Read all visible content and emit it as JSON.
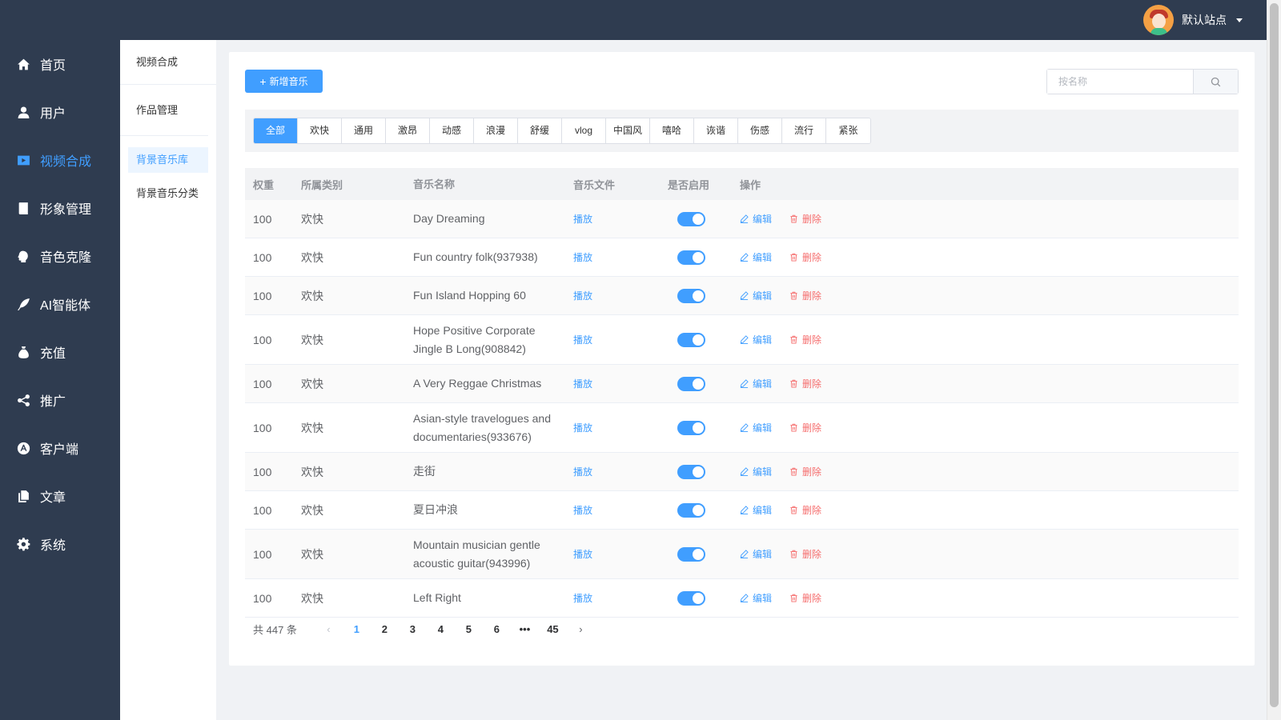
{
  "header": {
    "site_name": "默认站点"
  },
  "sidebar": {
    "items": [
      {
        "label": "首页",
        "icon": "home-icon",
        "active": false
      },
      {
        "label": "用户",
        "icon": "user-icon",
        "active": false
      },
      {
        "label": "视频合成",
        "icon": "video-icon",
        "active": true
      },
      {
        "label": "形象管理",
        "icon": "book-icon",
        "active": false
      },
      {
        "label": "音色克隆",
        "icon": "voice-icon",
        "active": false
      },
      {
        "label": "AI智能体",
        "icon": "feather-icon",
        "active": false
      },
      {
        "label": "充值",
        "icon": "money-bag-icon",
        "active": false
      },
      {
        "label": "推广",
        "icon": "share-icon",
        "active": false
      },
      {
        "label": "客户端",
        "icon": "app-store-icon",
        "active": false
      },
      {
        "label": "文章",
        "icon": "documents-icon",
        "active": false
      },
      {
        "label": "系统",
        "icon": "gear-icon",
        "active": false
      }
    ]
  },
  "subnav": {
    "title": "视频合成",
    "group": "作品管理",
    "items": [
      {
        "label": "背景音乐库",
        "active": true
      },
      {
        "label": "背景音乐分类",
        "active": false
      }
    ]
  },
  "toolbar": {
    "add_label": "新增音乐",
    "search_placeholder": "按名称"
  },
  "categories": [
    "全部",
    "欢快",
    "通用",
    "激昂",
    "动感",
    "浪漫",
    "舒缓",
    "vlog",
    "中国风",
    "嘻哈",
    "诙谐",
    "伤感",
    "流行",
    "紧张"
  ],
  "table": {
    "headers": {
      "weight": "权重",
      "category": "所属类别",
      "name": "音乐名称",
      "file": "音乐文件",
      "enabled": "是否启用",
      "ops": "操作"
    },
    "play_label": "播放",
    "edit_label": "编辑",
    "delete_label": "删除",
    "rows": [
      {
        "weight": "100",
        "category": "欢快",
        "name": "Day Dreaming",
        "enabled": true
      },
      {
        "weight": "100",
        "category": "欢快",
        "name": "Fun country folk(937938)",
        "enabled": true
      },
      {
        "weight": "100",
        "category": "欢快",
        "name": "Fun Island Hopping 60",
        "enabled": true
      },
      {
        "weight": "100",
        "category": "欢快",
        "name": "Hope Positive Corporate Jingle B Long(908842)",
        "enabled": true
      },
      {
        "weight": "100",
        "category": "欢快",
        "name": "A Very Reggae Christmas",
        "enabled": true
      },
      {
        "weight": "100",
        "category": "欢快",
        "name": "Asian-style travelogues and documentaries(933676)",
        "enabled": true
      },
      {
        "weight": "100",
        "category": "欢快",
        "name": "走街",
        "enabled": true
      },
      {
        "weight": "100",
        "category": "欢快",
        "name": "夏日冲浪",
        "enabled": true
      },
      {
        "weight": "100",
        "category": "欢快",
        "name": "Mountain musician gentle acoustic guitar(943996)",
        "enabled": true
      },
      {
        "weight": "100",
        "category": "欢快",
        "name": "Left Right",
        "enabled": true
      }
    ]
  },
  "pagination": {
    "total_text": "共 447 条",
    "pages": [
      "1",
      "2",
      "3",
      "4",
      "5",
      "6",
      "•••",
      "45"
    ],
    "current": "1"
  },
  "colors": {
    "sidebar_bg": "#2f3c50",
    "accent": "#409eff",
    "danger": "#f56c6c"
  }
}
